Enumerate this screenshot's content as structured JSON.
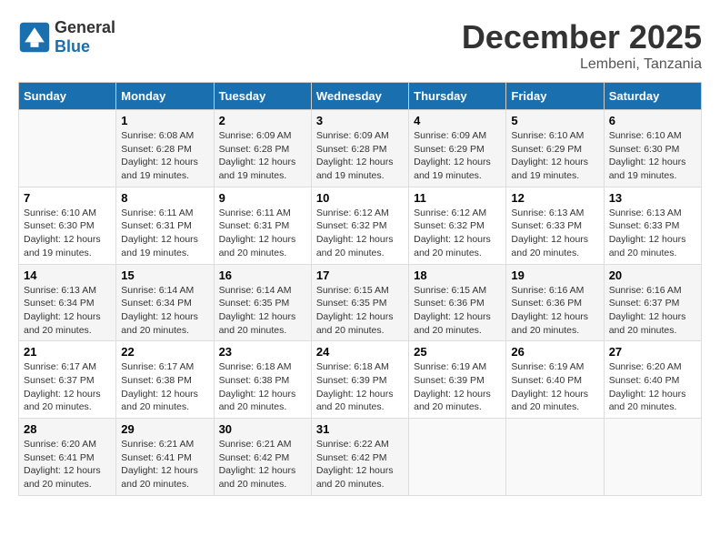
{
  "logo": {
    "general": "General",
    "blue": "Blue"
  },
  "title": "December 2025",
  "location": "Lembeni, Tanzania",
  "days_of_week": [
    "Sunday",
    "Monday",
    "Tuesday",
    "Wednesday",
    "Thursday",
    "Friday",
    "Saturday"
  ],
  "weeks": [
    [
      {
        "day": "",
        "sunrise": "",
        "sunset": "",
        "daylight": ""
      },
      {
        "day": "1",
        "sunrise": "Sunrise: 6:08 AM",
        "sunset": "Sunset: 6:28 PM",
        "daylight": "Daylight: 12 hours and 19 minutes."
      },
      {
        "day": "2",
        "sunrise": "Sunrise: 6:09 AM",
        "sunset": "Sunset: 6:28 PM",
        "daylight": "Daylight: 12 hours and 19 minutes."
      },
      {
        "day": "3",
        "sunrise": "Sunrise: 6:09 AM",
        "sunset": "Sunset: 6:28 PM",
        "daylight": "Daylight: 12 hours and 19 minutes."
      },
      {
        "day": "4",
        "sunrise": "Sunrise: 6:09 AM",
        "sunset": "Sunset: 6:29 PM",
        "daylight": "Daylight: 12 hours and 19 minutes."
      },
      {
        "day": "5",
        "sunrise": "Sunrise: 6:10 AM",
        "sunset": "Sunset: 6:29 PM",
        "daylight": "Daylight: 12 hours and 19 minutes."
      },
      {
        "day": "6",
        "sunrise": "Sunrise: 6:10 AM",
        "sunset": "Sunset: 6:30 PM",
        "daylight": "Daylight: 12 hours and 19 minutes."
      }
    ],
    [
      {
        "day": "7",
        "sunrise": "Sunrise: 6:10 AM",
        "sunset": "Sunset: 6:30 PM",
        "daylight": "Daylight: 12 hours and 19 minutes."
      },
      {
        "day": "8",
        "sunrise": "Sunrise: 6:11 AM",
        "sunset": "Sunset: 6:31 PM",
        "daylight": "Daylight: 12 hours and 19 minutes."
      },
      {
        "day": "9",
        "sunrise": "Sunrise: 6:11 AM",
        "sunset": "Sunset: 6:31 PM",
        "daylight": "Daylight: 12 hours and 20 minutes."
      },
      {
        "day": "10",
        "sunrise": "Sunrise: 6:12 AM",
        "sunset": "Sunset: 6:32 PM",
        "daylight": "Daylight: 12 hours and 20 minutes."
      },
      {
        "day": "11",
        "sunrise": "Sunrise: 6:12 AM",
        "sunset": "Sunset: 6:32 PM",
        "daylight": "Daylight: 12 hours and 20 minutes."
      },
      {
        "day": "12",
        "sunrise": "Sunrise: 6:13 AM",
        "sunset": "Sunset: 6:33 PM",
        "daylight": "Daylight: 12 hours and 20 minutes."
      },
      {
        "day": "13",
        "sunrise": "Sunrise: 6:13 AM",
        "sunset": "Sunset: 6:33 PM",
        "daylight": "Daylight: 12 hours and 20 minutes."
      }
    ],
    [
      {
        "day": "14",
        "sunrise": "Sunrise: 6:13 AM",
        "sunset": "Sunset: 6:34 PM",
        "daylight": "Daylight: 12 hours and 20 minutes."
      },
      {
        "day": "15",
        "sunrise": "Sunrise: 6:14 AM",
        "sunset": "Sunset: 6:34 PM",
        "daylight": "Daylight: 12 hours and 20 minutes."
      },
      {
        "day": "16",
        "sunrise": "Sunrise: 6:14 AM",
        "sunset": "Sunset: 6:35 PM",
        "daylight": "Daylight: 12 hours and 20 minutes."
      },
      {
        "day": "17",
        "sunrise": "Sunrise: 6:15 AM",
        "sunset": "Sunset: 6:35 PM",
        "daylight": "Daylight: 12 hours and 20 minutes."
      },
      {
        "day": "18",
        "sunrise": "Sunrise: 6:15 AM",
        "sunset": "Sunset: 6:36 PM",
        "daylight": "Daylight: 12 hours and 20 minutes."
      },
      {
        "day": "19",
        "sunrise": "Sunrise: 6:16 AM",
        "sunset": "Sunset: 6:36 PM",
        "daylight": "Daylight: 12 hours and 20 minutes."
      },
      {
        "day": "20",
        "sunrise": "Sunrise: 6:16 AM",
        "sunset": "Sunset: 6:37 PM",
        "daylight": "Daylight: 12 hours and 20 minutes."
      }
    ],
    [
      {
        "day": "21",
        "sunrise": "Sunrise: 6:17 AM",
        "sunset": "Sunset: 6:37 PM",
        "daylight": "Daylight: 12 hours and 20 minutes."
      },
      {
        "day": "22",
        "sunrise": "Sunrise: 6:17 AM",
        "sunset": "Sunset: 6:38 PM",
        "daylight": "Daylight: 12 hours and 20 minutes."
      },
      {
        "day": "23",
        "sunrise": "Sunrise: 6:18 AM",
        "sunset": "Sunset: 6:38 PM",
        "daylight": "Daylight: 12 hours and 20 minutes."
      },
      {
        "day": "24",
        "sunrise": "Sunrise: 6:18 AM",
        "sunset": "Sunset: 6:39 PM",
        "daylight": "Daylight: 12 hours and 20 minutes."
      },
      {
        "day": "25",
        "sunrise": "Sunrise: 6:19 AM",
        "sunset": "Sunset: 6:39 PM",
        "daylight": "Daylight: 12 hours and 20 minutes."
      },
      {
        "day": "26",
        "sunrise": "Sunrise: 6:19 AM",
        "sunset": "Sunset: 6:40 PM",
        "daylight": "Daylight: 12 hours and 20 minutes."
      },
      {
        "day": "27",
        "sunrise": "Sunrise: 6:20 AM",
        "sunset": "Sunset: 6:40 PM",
        "daylight": "Daylight: 12 hours and 20 minutes."
      }
    ],
    [
      {
        "day": "28",
        "sunrise": "Sunrise: 6:20 AM",
        "sunset": "Sunset: 6:41 PM",
        "daylight": "Daylight: 12 hours and 20 minutes."
      },
      {
        "day": "29",
        "sunrise": "Sunrise: 6:21 AM",
        "sunset": "Sunset: 6:41 PM",
        "daylight": "Daylight: 12 hours and 20 minutes."
      },
      {
        "day": "30",
        "sunrise": "Sunrise: 6:21 AM",
        "sunset": "Sunset: 6:42 PM",
        "daylight": "Daylight: 12 hours and 20 minutes."
      },
      {
        "day": "31",
        "sunrise": "Sunrise: 6:22 AM",
        "sunset": "Sunset: 6:42 PM",
        "daylight": "Daylight: 12 hours and 20 minutes."
      },
      {
        "day": "",
        "sunrise": "",
        "sunset": "",
        "daylight": ""
      },
      {
        "day": "",
        "sunrise": "",
        "sunset": "",
        "daylight": ""
      },
      {
        "day": "",
        "sunrise": "",
        "sunset": "",
        "daylight": ""
      }
    ]
  ]
}
